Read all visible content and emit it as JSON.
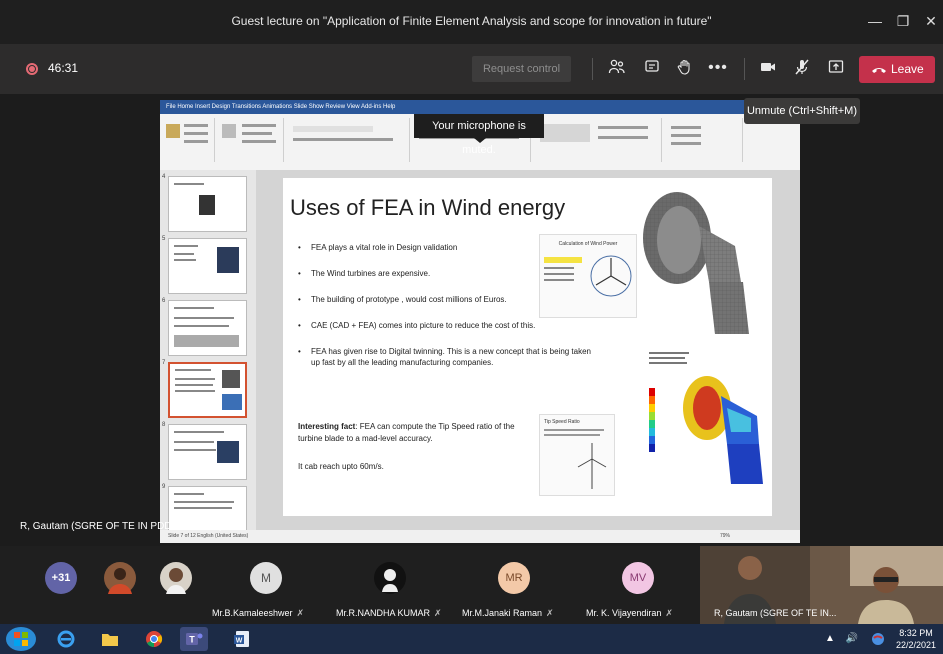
{
  "window": {
    "title": "Guest lecture on \"Application of Finite Element Analysis and scope for innovation in future\"",
    "minimize_glyph": "—",
    "restore_glyph": "❐",
    "close_glyph": "✕"
  },
  "meeting": {
    "timer": "46:31",
    "request_control_label": "Request control",
    "leave_label": "Leave",
    "unmute_tooltip": "Unmute (Ctrl+Shift+M)",
    "icons": [
      "participants-icon",
      "chat-icon",
      "raise-hand-icon",
      "more-options-icon",
      "camera-icon",
      "mic-off-icon",
      "share-tray-icon",
      "phone-icon"
    ]
  },
  "shared_screen": {
    "muted_notice": "Your microphone is muted.",
    "ribbon_tabs": "File   Home   Insert   Design   Transitions   Animations   Slide Show   Review   View   Add-ins   Help",
    "slide": {
      "title": "Uses of FEA in Wind energy",
      "bullets": [
        "FEA plays a vital role in Design validation",
        "The Wind turbines are expensive.",
        "The building of prototype , would cost millions of Euros.",
        "CAE (CAD + FEA) comes into picture to reduce the cost of this.",
        "FEA has given rise to Digital twinning. This is a new concept that is being taken up fast by all the leading manufacturing companies."
      ],
      "fact_label": "Interesting fact",
      "fact_text": ": FEA can compute the Tip Speed ratio of the turbine blade to a mad-level accuracy.",
      "fact_2": "It cab reach upto 60m/s.",
      "figure_wind_power_caption": "Calculation of Wind Power",
      "figure_tip_speed_caption": "Tip Speed Ratio"
    },
    "thumbnail_numbers": [
      "4",
      "5",
      "6",
      "7",
      "8",
      "9"
    ],
    "status_text": "Slide 7 of 12     English (United States)",
    "zoom_text": "79%"
  },
  "presenter": "R, Gautam (SGRE OF TE IN PDDD GEN AN)",
  "participants": [
    {
      "initials": "+31",
      "name": "",
      "color": "#6264a7"
    },
    {
      "initials": "",
      "name": "",
      "color": "#8a5a3c"
    },
    {
      "initials": "",
      "name": "",
      "color": "#c8c2b8"
    },
    {
      "initials": "M",
      "name": "Mr.B.Kamaleeshwer",
      "color": "#e0e0e0"
    },
    {
      "initials": "",
      "name": "Mr.R.NANDHA KUMAR",
      "color": "#111111"
    },
    {
      "initials": "MR",
      "name": "Mr.M.Janaki Raman",
      "color": "#f3c9a8"
    },
    {
      "initials": "MV",
      "name": "Mr. K. Vijayendiran",
      "color": "#f2c6e3"
    },
    {
      "initials": "",
      "name": "R, Gautam (SGRE OF TE IN...",
      "color": "#5e4a3a"
    }
  ],
  "taskbar": {
    "time": "8:32 PM",
    "date": "22/2/2021"
  }
}
